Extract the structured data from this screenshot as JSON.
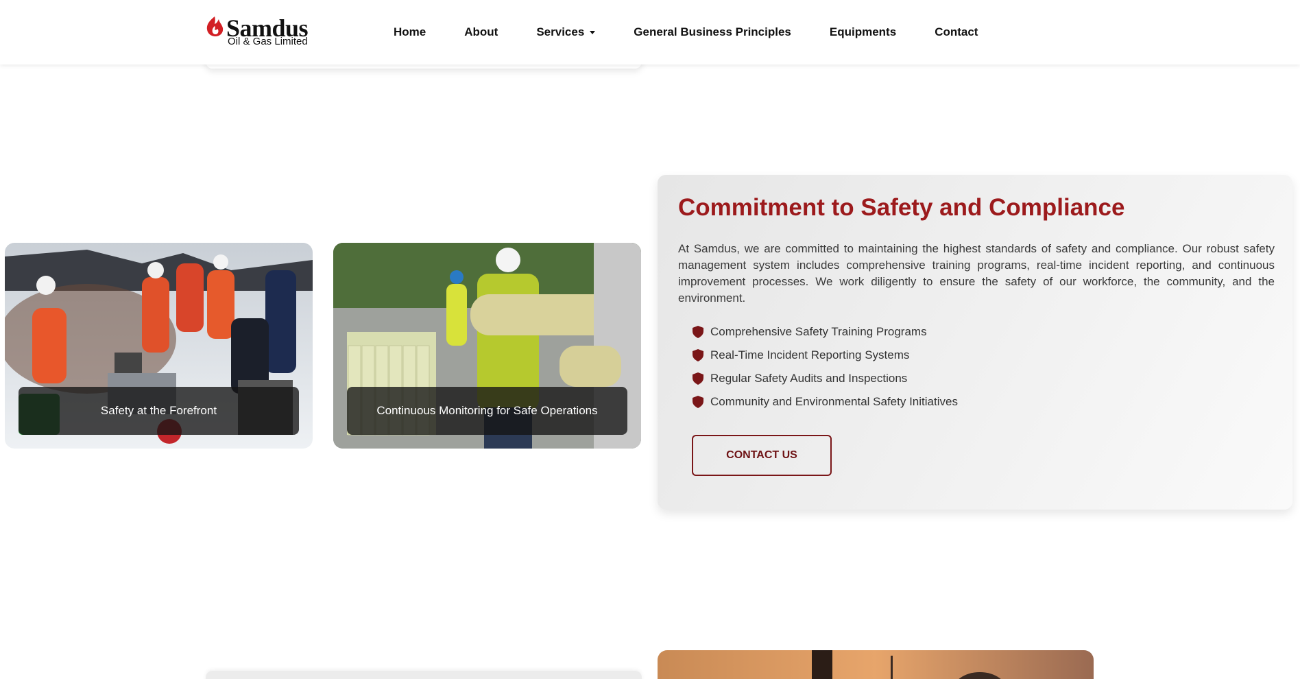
{
  "brand": {
    "name": "Samdus",
    "subtitle": "Oil & Gas Limited",
    "accent_color": "#9c1a1c",
    "logo_icon": "flame-icon"
  },
  "nav": {
    "items": [
      {
        "label": "Home"
      },
      {
        "label": "About"
      },
      {
        "label": "Services"
      },
      {
        "label": "General Business Principles"
      },
      {
        "label": "Equipments"
      },
      {
        "label": "Contact"
      }
    ],
    "services_caret_icon": "caret-down-icon"
  },
  "gallery": {
    "cards": [
      {
        "caption": "Safety at the Forefront"
      },
      {
        "caption": "Continuous Monitoring for Safe Operations"
      }
    ]
  },
  "safety": {
    "title": "Commitment to Safety and Compliance",
    "body": "At Samdus, we are committed to maintaining the highest standards of safety and compliance. Our robust safety management system includes comprehensive training programs, real-time incident reporting, and continuous improvement processes. We work diligently to ensure the safety of our workforce, the community, and the environment.",
    "bullet_icon": "shield-icon",
    "bullets": [
      "Comprehensive Safety Training Programs",
      "Real-Time Incident Reporting Systems",
      "Regular Safety Audits and Inspections",
      "Community and Environmental Safety Initiatives"
    ],
    "cta_label": "CONTACT US"
  }
}
